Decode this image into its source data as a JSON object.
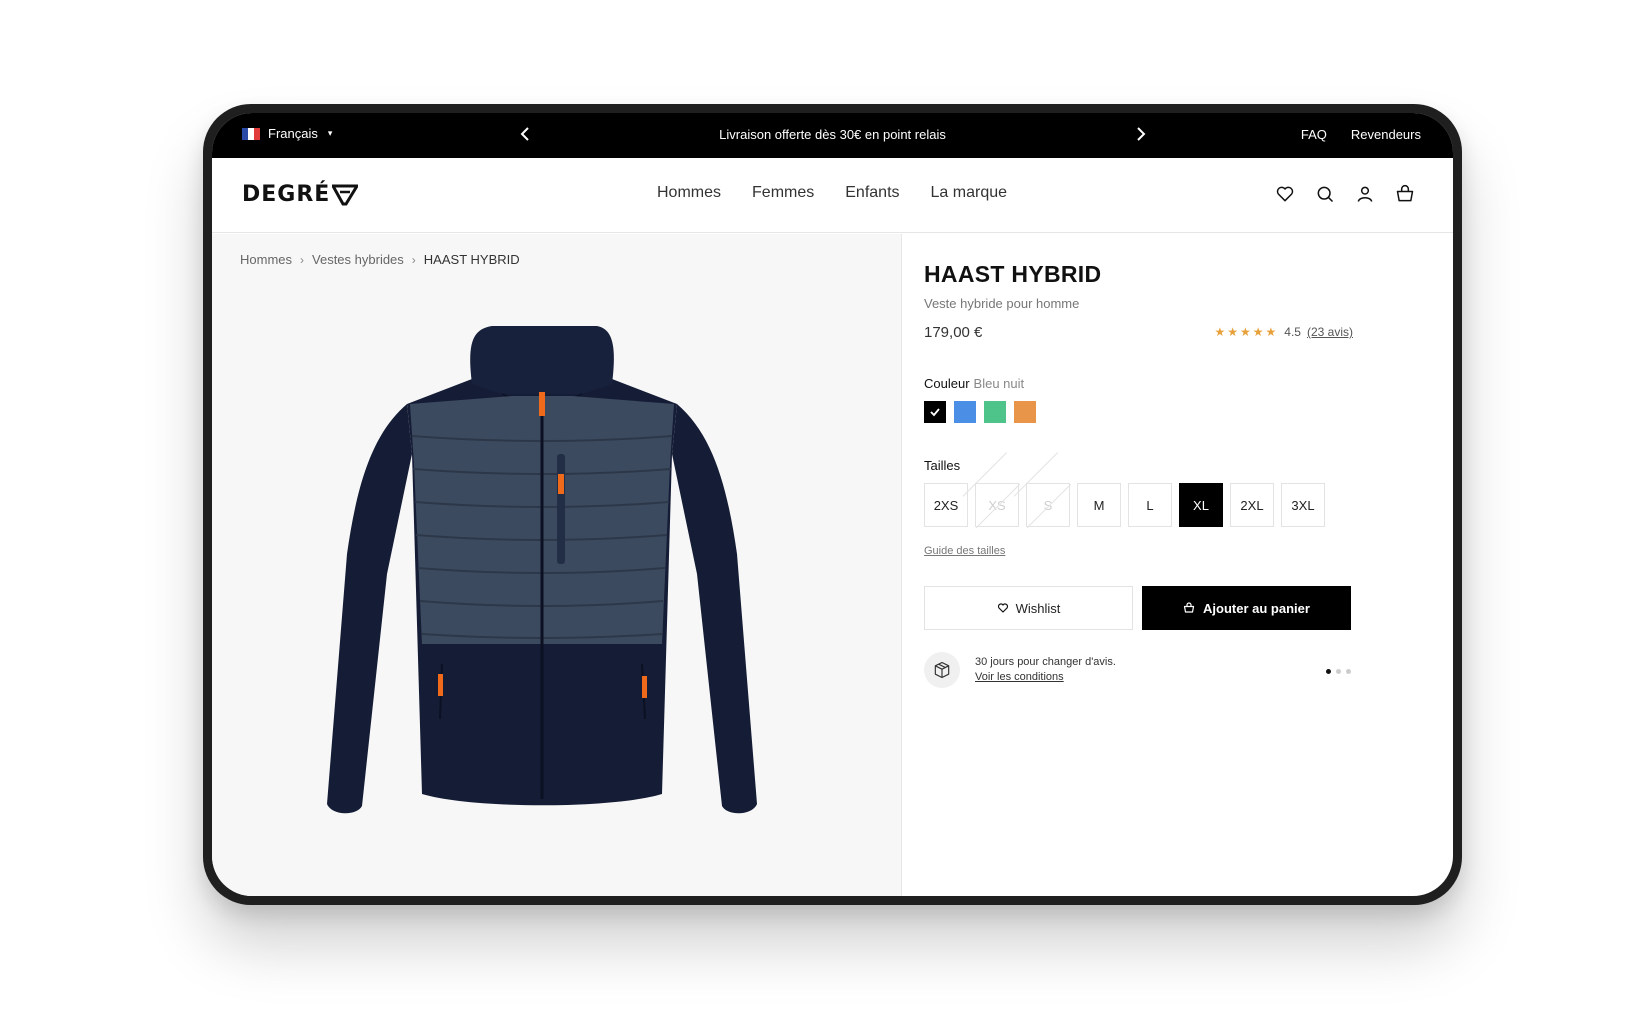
{
  "topbar": {
    "language": "Français",
    "promo": "Livraison offerte dès 30€ en point relais",
    "links": [
      "FAQ",
      "Revendeurs"
    ]
  },
  "header": {
    "logo": "DEGRÉ",
    "nav": [
      "Hommes",
      "Femmes",
      "Enfants",
      "La marque"
    ],
    "icons": [
      "heart-icon",
      "search-icon",
      "user-icon",
      "basket-icon"
    ]
  },
  "breadcrumb": [
    "Hommes",
    "Vestes hybrides",
    "HAAST HYBRID"
  ],
  "product": {
    "title": "HAAST HYBRID",
    "subtitle": "Veste hybride pour homme",
    "price": "179,00 €",
    "rating": "4.5",
    "rating_value": 4.5,
    "reviews": "(23 avis)",
    "color_label": "Couleur",
    "color_value": "Bleu nuit",
    "colors": [
      "#000000",
      "#4a8ee6",
      "#4fc48a",
      "#e8954a"
    ],
    "sizes_label": "Tailles",
    "sizes": [
      {
        "label": "2XS",
        "state": "available"
      },
      {
        "label": "XS",
        "state": "unavailable"
      },
      {
        "label": "S",
        "state": "unavailable"
      },
      {
        "label": "M",
        "state": "available"
      },
      {
        "label": "L",
        "state": "available"
      },
      {
        "label": "XL",
        "state": "selected"
      },
      {
        "label": "2XL",
        "state": "available"
      },
      {
        "label": "3XL",
        "state": "available"
      }
    ],
    "size_guide": "Guide des tailles",
    "wishlist_button": "Wishlist",
    "cart_button": "Ajouter au panier",
    "returns_text": "30 jours pour changer d'avis.",
    "returns_link": "Voir les conditions"
  },
  "colors": {
    "accent_star": "#e8a13a",
    "jacket_dark": "#151d36",
    "jacket_panel": "#3c4a5f",
    "zip_orange": "#f06a1c"
  }
}
